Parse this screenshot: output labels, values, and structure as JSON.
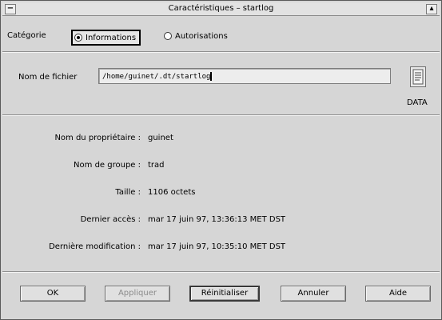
{
  "window": {
    "title": "Caractéristiques – startlog",
    "menu_glyph": "−",
    "maximize_glyph": "▴"
  },
  "category": {
    "label": "Catégorie",
    "options": [
      {
        "label": "Informations",
        "selected": true
      },
      {
        "label": "Autorisations",
        "selected": false
      }
    ]
  },
  "file": {
    "label": "Nom de fichier",
    "value": "/home/guinet/.dt/startlog",
    "icon_name": "data-file-icon",
    "icon_label": "DATA"
  },
  "info": [
    {
      "label": "Nom du propriétaire :",
      "value": "guinet"
    },
    {
      "label": "Nom de groupe :",
      "value": "trad"
    },
    {
      "label": "Taille :",
      "value": "1106 octets"
    },
    {
      "label": "Dernier accès :",
      "value": "mar 17 juin 97, 13:36:13 MET DST"
    },
    {
      "label": "Dernière modification :",
      "value": "mar 17 juin 97, 10:35:10 MET DST"
    }
  ],
  "buttons": {
    "ok": "OK",
    "apply": "Appliquer",
    "reset": "Réinitialiser",
    "cancel": "Annuler",
    "help": "Aide"
  }
}
